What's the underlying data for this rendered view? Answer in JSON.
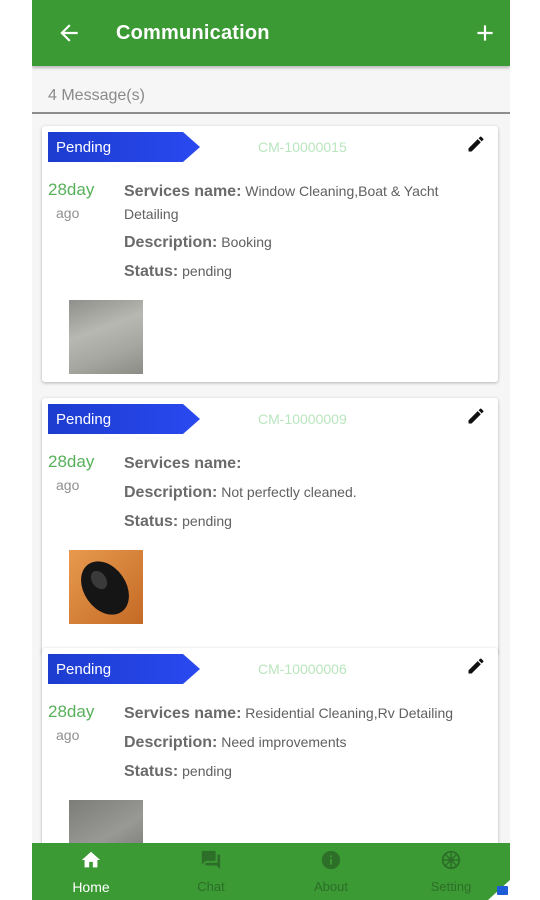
{
  "header": {
    "title": "Communication",
    "back_icon": "arrow-left-icon",
    "add_icon": "plus-icon"
  },
  "message_count": "4 Message(s)",
  "colors": {
    "brand_green": "#3b9a34",
    "badge_blue": "#2a49f0",
    "age_green": "#58b05a"
  },
  "labels": {
    "services_name": "Services name:",
    "description": "Description:",
    "status": "Status:"
  },
  "cards": [
    {
      "badge": "Pending",
      "code": "CM-10000015",
      "age_num": "28day",
      "age_unit": "ago",
      "services_name": "Window Cleaning,Boat & Yacht Detailing",
      "description": "Booking",
      "status": "pending",
      "thumbnail": "grey-surface-photo"
    },
    {
      "badge": "Pending",
      "code": "CM-10000009",
      "age_num": "28day",
      "age_unit": "ago",
      "services_name": "",
      "description": "Not perfectly cleaned.",
      "status": "pending",
      "thumbnail": "computer-mouse-photo"
    },
    {
      "badge": "Pending",
      "code": "CM-10000006",
      "age_num": "28day",
      "age_unit": "ago",
      "services_name": "Residential Cleaning,Rv Detailing",
      "description": "Need improvements",
      "status": "pending",
      "thumbnail": "carpet-photo"
    }
  ],
  "bottom_nav": [
    {
      "label": "Home",
      "icon": "home-icon",
      "active": true
    },
    {
      "label": "Chat",
      "icon": "chat-icon",
      "active": false
    },
    {
      "label": "About",
      "icon": "info-icon",
      "active": false
    },
    {
      "label": "Setting",
      "icon": "settings-icon",
      "active": false
    }
  ]
}
